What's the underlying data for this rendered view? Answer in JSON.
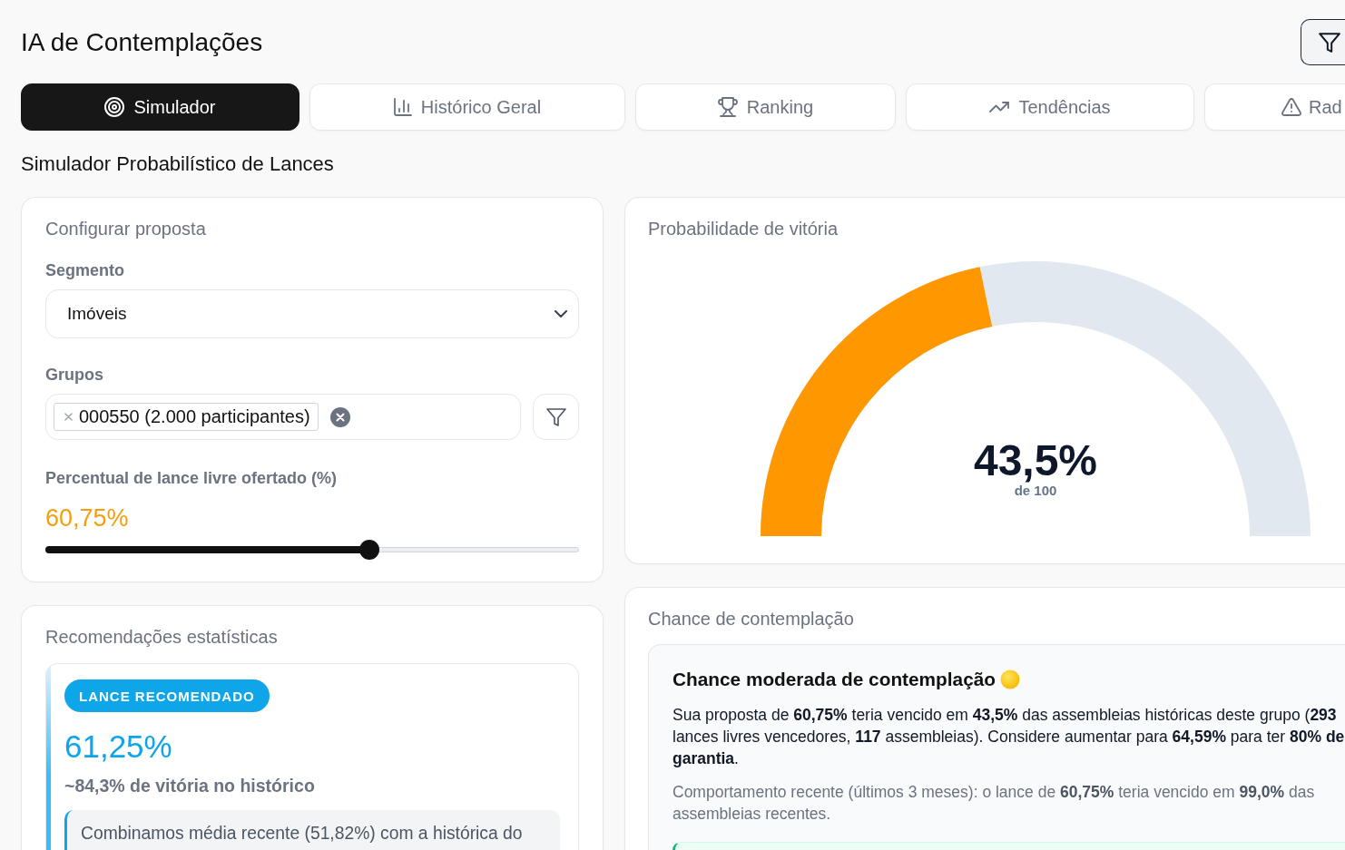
{
  "header": {
    "title": "IA de Contemplações"
  },
  "tabs": [
    {
      "label": "Simulador",
      "selected": true
    },
    {
      "label": "Histórico Geral",
      "selected": false
    },
    {
      "label": "Ranking",
      "selected": false
    },
    {
      "label": "Tendências",
      "selected": false
    },
    {
      "label": "Rad",
      "selected": false
    }
  ],
  "section_title": "Simulador Probabilístico de Lances",
  "config": {
    "title": "Configurar proposta",
    "segment": {
      "label": "Segmento",
      "value": "Imóveis"
    },
    "groups": {
      "label": "Grupos",
      "chips": [
        "000550 (2.000 participantes)"
      ]
    },
    "bid": {
      "label": "Percentual de lance livre ofertado (%)",
      "value": "60,75%",
      "level": 0.6075
    }
  },
  "probability": {
    "title": "Probabilidade de vitória",
    "gauge": {
      "level": 0.435,
      "value": "43,5%",
      "caption": "de 100"
    }
  },
  "recommendations": {
    "title": "Recomendações estatísticas",
    "badge": "LANCE RECOMENDADO",
    "value": "61,25%",
    "win_rate": "~84,3% de vitória no histórico",
    "note": "Combinamos média recente (51,82%) com a histórica do"
  },
  "chance": {
    "title": "Chance de contemplação",
    "heading": "Chance moderada de contemplação",
    "summary": "Sua proposta de **60,75%** teria vencido em **43,5%** das assembleias históricas deste grupo (**293** lances livres vencedores, **117** assembleias). Considere aumentar para **64,59%** para ter **80% de garantia**.",
    "recent": "Comportamento recente (últimos 3 meses): o lance de **60,75%** teria vencido em **99,0%** das assembleias recentes."
  }
}
